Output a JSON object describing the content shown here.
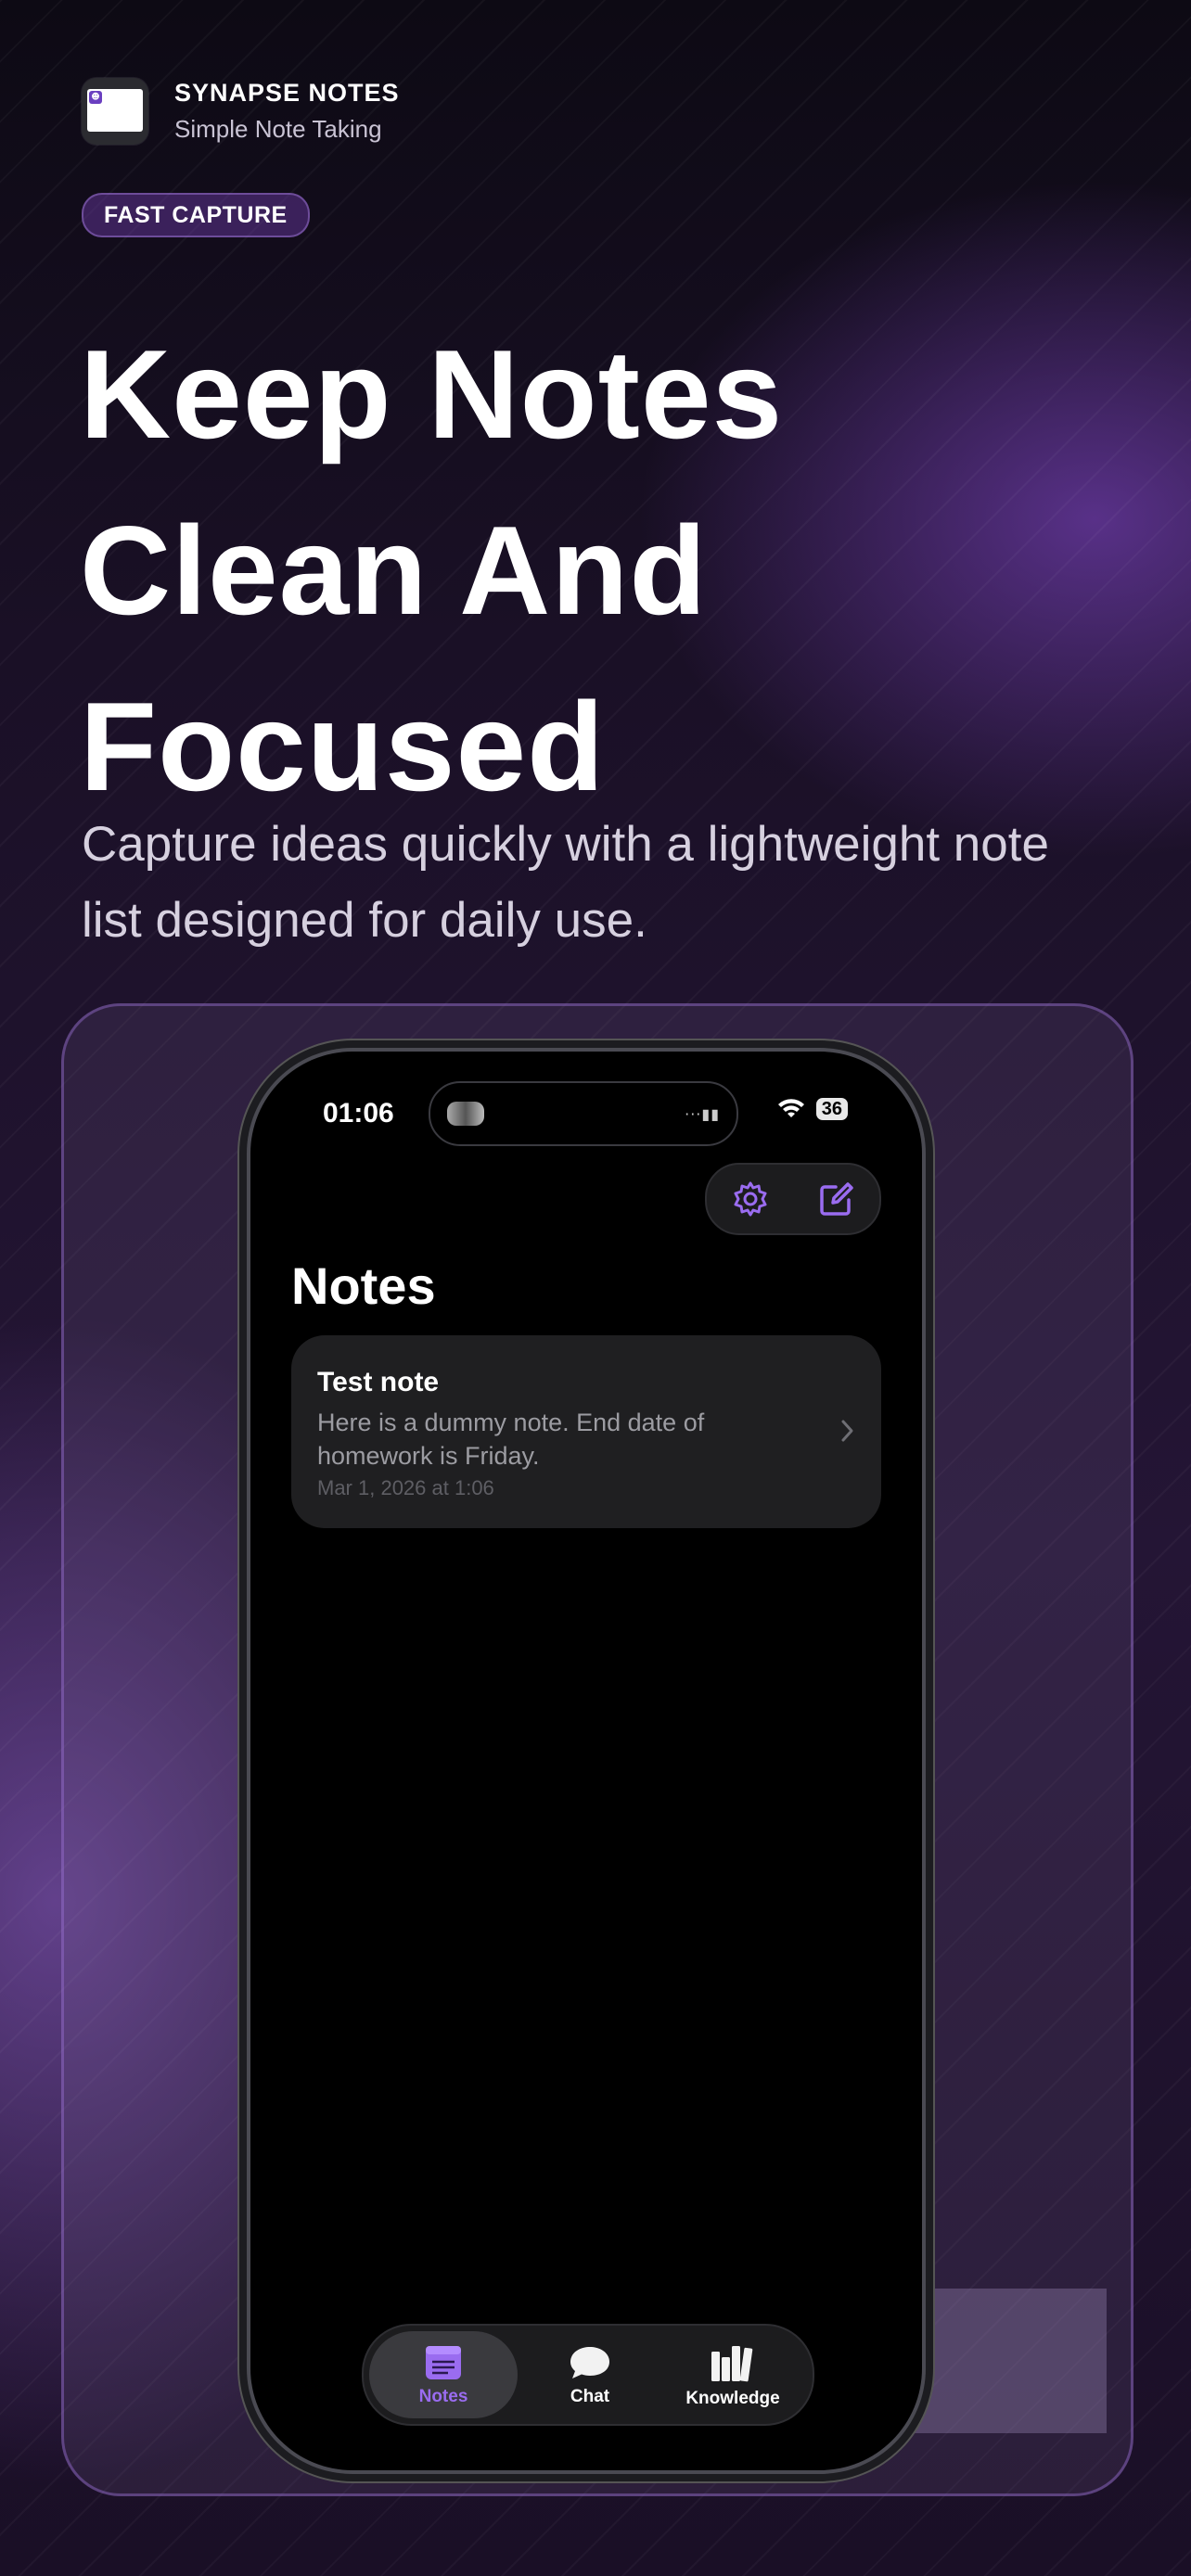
{
  "brand": {
    "name": "SYNAPSE NOTES",
    "tagline": "Simple Note Taking"
  },
  "badge": "FAST CAPTURE",
  "headline": [
    "Keep Notes",
    "Clean And",
    "Focused"
  ],
  "subtitle": "Capture ideas quickly with a lightweight note list designed for daily use.",
  "phone": {
    "status": {
      "time": "01:06",
      "battery": "36"
    },
    "toolbar": {
      "icons": [
        "gear-icon",
        "compose-icon"
      ]
    },
    "page_title": "Notes",
    "notes": [
      {
        "title": "Test note",
        "body": "Here is a dummy note. End date of homework is Friday.",
        "date": "Mar 1, 2026 at 1:06"
      }
    ],
    "tabs": [
      {
        "label": "Notes",
        "icon": "notes-icon",
        "active": true
      },
      {
        "label": "Chat",
        "icon": "chat-bubble-icon",
        "active": false
      },
      {
        "label": "Knowledge",
        "icon": "books-icon",
        "active": false
      }
    ]
  },
  "colors": {
    "accent": "#9a6cf0",
    "background": "#1a1026",
    "card": "#1f1f21"
  }
}
